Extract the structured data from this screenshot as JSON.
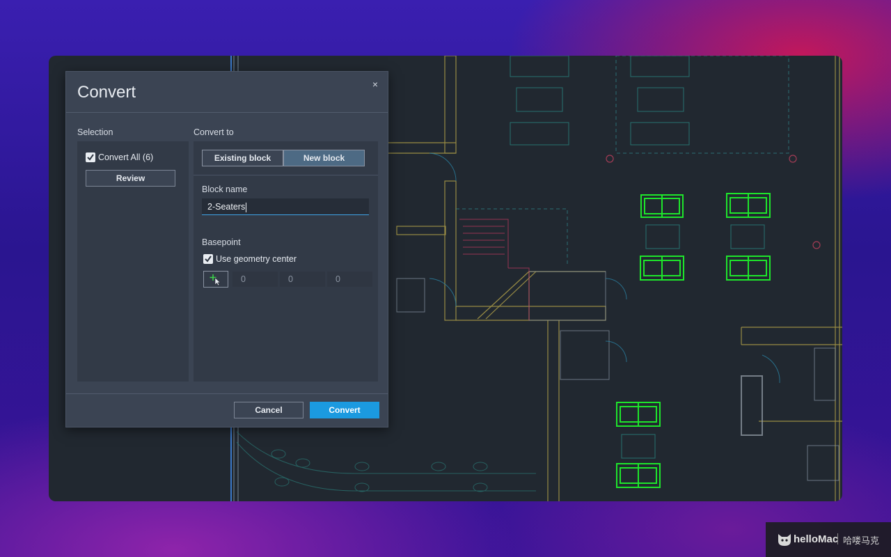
{
  "dialog": {
    "title": "Convert",
    "close_symbol": "×",
    "selection_label": "Selection",
    "convert_all_label": "Convert All (6)",
    "convert_all_checked": true,
    "review_label": "Review",
    "convert_to_label": "Convert to",
    "tabs": [
      {
        "label": "Existing block",
        "selected": false
      },
      {
        "label": "New block",
        "selected": true
      }
    ],
    "block_name_label": "Block name",
    "block_name_value": "2-Seaters",
    "basepoint_label": "Basepoint",
    "use_geometry_center_label": "Use geometry center",
    "use_geometry_center_checked": true,
    "coords": [
      "0",
      "0",
      "0"
    ],
    "cancel_label": "Cancel",
    "convert_label": "Convert"
  },
  "colors": {
    "primary_button": "#1b9ae0",
    "selected_sofa": "#1ee62b",
    "cad_background": "#212830"
  },
  "watermark": {
    "brand": "helloMac",
    "chinese": "哈喽马克"
  },
  "icons": {
    "close": "close-icon",
    "checkbox": "checkmark-icon",
    "pick_point": "pick-point-icon",
    "logo": "cat-logo-icon"
  }
}
